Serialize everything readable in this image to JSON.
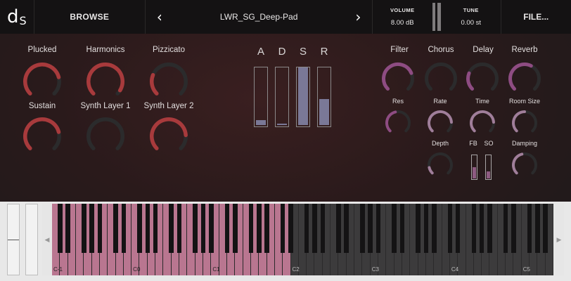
{
  "header": {
    "logo_d": "d",
    "logo_s": "S",
    "browse_label": "BROWSE",
    "prev_arrow": "‹",
    "next_arrow": "›",
    "preset_name": "LWR_SG_Deep-Pad",
    "volume_label": "VOLUME",
    "volume_value": "8.00 dB",
    "tune_label": "TUNE",
    "tune_value": "0.00 st",
    "file_label": "FILE..."
  },
  "layers": {
    "plucked": {
      "label": "Plucked",
      "value": 0.78
    },
    "harmonics": {
      "label": "Harmonics",
      "value": 0.95
    },
    "pizzicato": {
      "label": "Pizzicato",
      "value": 0.25
    },
    "sustain": {
      "label": "Sustain",
      "value": 0.78
    },
    "synth_layer_1": {
      "label": "Synth Layer 1",
      "value": 0.0
    },
    "synth_layer_2": {
      "label": "Synth Layer 2",
      "value": 0.82
    }
  },
  "adsr": {
    "letters": [
      "A",
      "D",
      "S",
      "R"
    ],
    "values": [
      0.08,
      0.02,
      1.0,
      0.45
    ]
  },
  "effects": {
    "filter": {
      "label": "Filter",
      "value": 0.75
    },
    "chorus": {
      "label": "Chorus",
      "value": 0.0
    },
    "delay": {
      "label": "Delay",
      "value": 0.25
    },
    "reverb": {
      "label": "Reverb",
      "value": 0.6
    },
    "res": {
      "label": "Res",
      "value": 0.45
    },
    "rate": {
      "label": "Rate",
      "value": 0.82
    },
    "time": {
      "label": "Time",
      "value": 0.82
    },
    "room_size": {
      "label": "Room Size",
      "value": 0.5
    },
    "depth": {
      "label": "Depth",
      "value": 0.12
    },
    "damping": {
      "label": "Damping",
      "value": 0.45
    },
    "fb_label": "FB",
    "so_label": "SO",
    "fb_value": 0.5,
    "so_value": 0.3
  },
  "keyboard": {
    "octave_labels": [
      "C-1",
      "C0",
      "C1",
      "C2",
      "C3",
      "C4",
      "C5"
    ],
    "range_left_arrow": "◀",
    "range_right_arrow": "▶",
    "active_white_keys": 30,
    "total_white_keys": 63
  },
  "colors": {
    "red_arc": "#a83a3c",
    "purple_arc": "#8e4c82",
    "light_purple_arc": "#a07e9a",
    "track": "#2b2b2c",
    "key_active": "#b97690",
    "key_inactive": "#3c3b3c"
  }
}
